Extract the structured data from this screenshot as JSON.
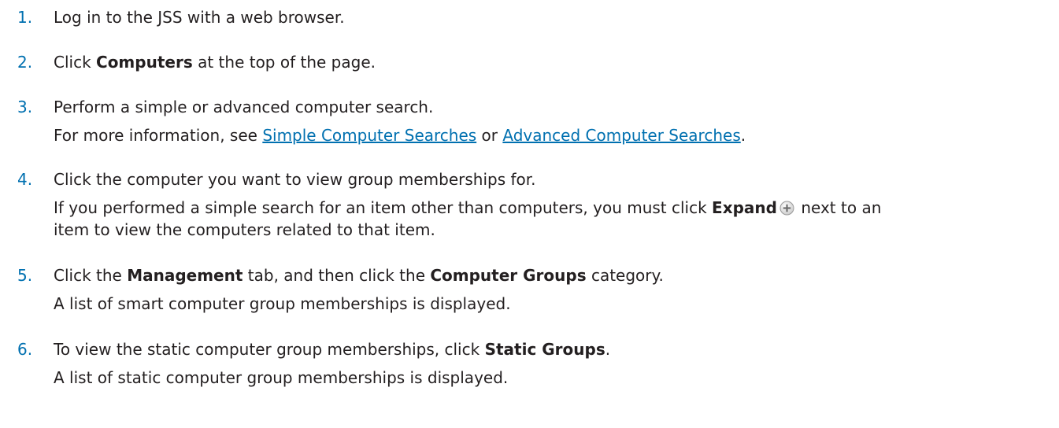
{
  "steps": [
    {
      "number": "1.",
      "text": "Log in to the JSS with a web browser."
    },
    {
      "number": "2.",
      "pre": "Click ",
      "bold": "Computers",
      "post": " at the top of the page."
    },
    {
      "number": "3.",
      "text": "Perform a simple or advanced computer search.",
      "note": {
        "pre": "For more information, see ",
        "link1": "Simple Computer Searches",
        "mid": " or ",
        "link2": "Advanced Computer Searches",
        "post": "."
      }
    },
    {
      "number": "4.",
      "text": "Click the computer you want to view group memberships for.",
      "note": {
        "pre": "If you performed a simple search for an item other than computers, you must click ",
        "bold": "Expand",
        "post": " next to an item to view the computers related to that item.",
        "icon": "expand-plus-icon"
      }
    },
    {
      "number": "5.",
      "pre": "Click the ",
      "bold1": "Management",
      "mid": " tab, and then click the ",
      "bold2": "Computer Groups",
      "post": " category.",
      "note": "A list of smart computer group memberships is displayed."
    },
    {
      "number": "6.",
      "pre": "To view the static computer group memberships, click ",
      "bold": "Static Groups",
      "post": ".",
      "note": "A list of static computer group memberships is displayed."
    }
  ],
  "colors": {
    "text": "#231f20",
    "accent": "#0070b0"
  }
}
